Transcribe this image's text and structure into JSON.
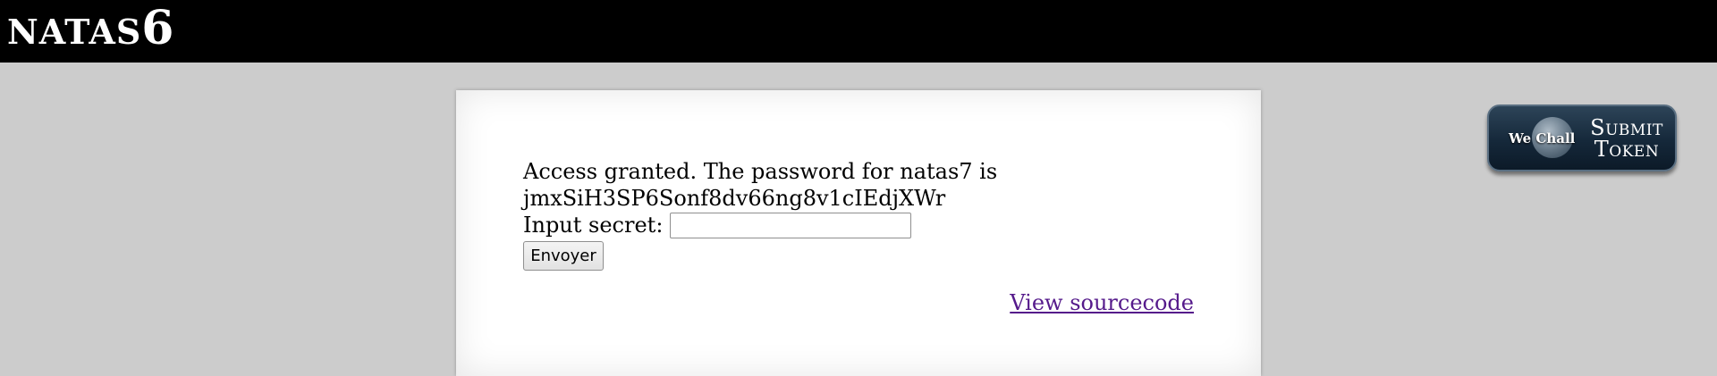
{
  "header": {
    "title_prefix": "NATAS",
    "title_level": "6"
  },
  "main": {
    "message_line1": "Access granted. The password for natas7 is",
    "message_line2": "jmxSiH3SP6Sonf8dv66ng8v1cIEdjXWr",
    "input_label": "Input secret:",
    "input_value": "",
    "input_placeholder": "",
    "submit_label": "Envoyer",
    "source_link_label": "View sourcecode"
  },
  "token_button": {
    "brand": "We Chall",
    "line1": "Submit",
    "line2": "Token",
    "icon": "globe-icon",
    "color": "#15283a"
  },
  "colors": {
    "header_bg": "#000000",
    "page_bg": "#cccccc",
    "content_bg": "#ffffff",
    "link_visited": "#551a8b"
  }
}
